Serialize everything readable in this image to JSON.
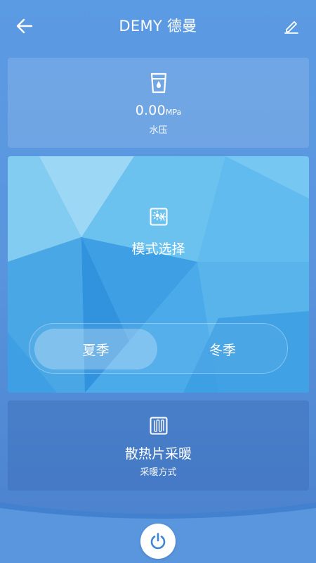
{
  "header": {
    "title": "DEMY 德曼",
    "back_icon": "arrow-left-icon",
    "edit_icon": "pencil-icon"
  },
  "pressure": {
    "icon": "water-cup-icon",
    "value": "0.00",
    "unit": "MPa",
    "label": "水压"
  },
  "mode": {
    "icon": "mode-icon",
    "title": "模式选择",
    "options": [
      {
        "label": "夏季",
        "selected": true
      },
      {
        "label": "冬季",
        "selected": false
      }
    ]
  },
  "heating": {
    "icon": "radiator-icon",
    "title": "散热片采暖",
    "label": "采暖方式"
  },
  "footer": {
    "power_icon": "power-icon"
  },
  "colors": {
    "background": "#5a96de",
    "mode_card": "#52b1ea",
    "accent": "#3f86d6",
    "text": "#ffffff"
  }
}
